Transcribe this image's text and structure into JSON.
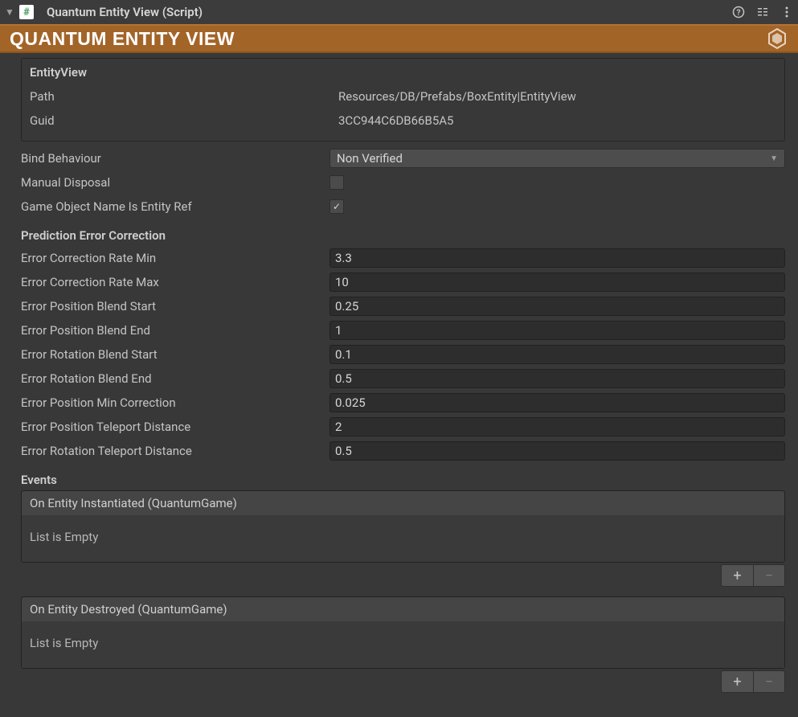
{
  "header": {
    "title": "Quantum Entity View (Script)"
  },
  "banner": {
    "title": "QUANTUM ENTITY VIEW"
  },
  "entity": {
    "section_title": "EntityView",
    "path_label": "Path",
    "path_value": "Resources/DB/Prefabs/BoxEntity|EntityView",
    "guid_label": "Guid",
    "guid_value": "3CC944C6DB66B5A5"
  },
  "props": {
    "bind_behaviour_label": "Bind Behaviour",
    "bind_behaviour_value": "Non Verified",
    "manual_disposal_label": "Manual Disposal",
    "manual_disposal_checked": false,
    "go_name_label": "Game Object Name Is Entity Ref",
    "go_name_checked": true
  },
  "prediction": {
    "section_title": "Prediction Error Correction",
    "fields": [
      {
        "label": "Error Correction Rate Min",
        "value": "3.3"
      },
      {
        "label": "Error Correction Rate Max",
        "value": "10"
      },
      {
        "label": "Error Position Blend Start",
        "value": "0.25"
      },
      {
        "label": "Error Position Blend End",
        "value": "1"
      },
      {
        "label": "Error Rotation Blend Start",
        "value": "0.1"
      },
      {
        "label": "Error Rotation Blend End",
        "value": "0.5"
      },
      {
        "label": "Error Position Min Correction",
        "value": "0.025"
      },
      {
        "label": "Error Position Teleport Distance",
        "value": "2"
      },
      {
        "label": "Error Rotation Teleport Distance",
        "value": "0.5"
      }
    ]
  },
  "events": {
    "section_title": "Events",
    "on_instantiated": {
      "header": "On Entity Instantiated (QuantumGame)",
      "body": "List is Empty"
    },
    "on_destroyed": {
      "header": "On Entity Destroyed (QuantumGame)",
      "body": "List is Empty"
    }
  }
}
